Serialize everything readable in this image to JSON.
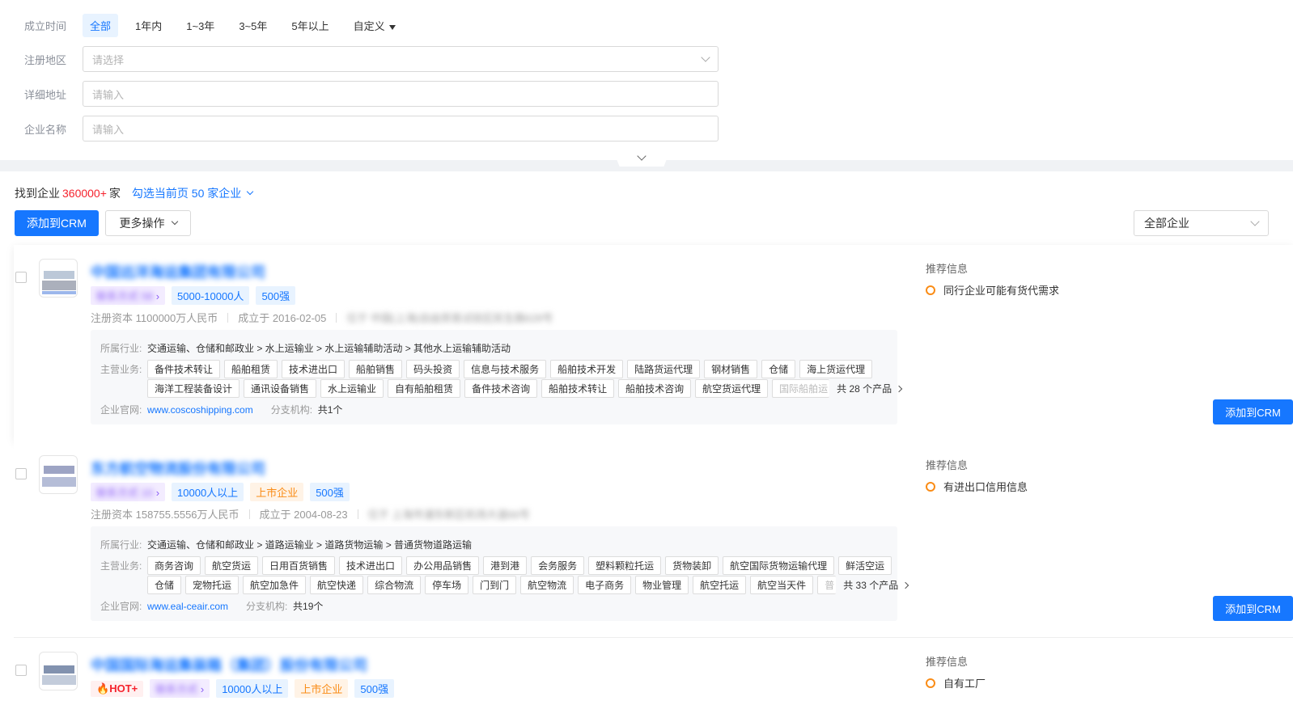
{
  "filters": {
    "founded": {
      "label": "成立时间",
      "options": [
        "全部",
        "1年内",
        "1~3年",
        "3~5年",
        "5年以上"
      ],
      "custom": "自定义"
    },
    "region": {
      "label": "注册地区",
      "placeholder": "请选择"
    },
    "address": {
      "label": "详细地址",
      "placeholder": "请输入"
    },
    "company_name": {
      "label": "企业名称",
      "placeholder": "请输入"
    }
  },
  "results": {
    "prefix": "找到企业",
    "count": "360000+",
    "suffix": "家",
    "select_page": "勾选当前页 50 家企业",
    "add_crm": "添加到CRM",
    "more_ops": "更多操作",
    "scope": "全部企业"
  },
  "companies": [
    {
      "name": "中国远洋海运集团有限公司",
      "contact_tag": "联系方式 58",
      "tags": [
        "5000-10000人",
        "500强"
      ],
      "capital": "注册资本 1100000万人民币",
      "founded": "成立于 2016-02-05",
      "location": "位于 中国(上海)自由贸易试验区民生路628号",
      "industry_label": "所属行业:",
      "industry": "交通运输、仓储和邮政业 > 水上运输业 > 水上运输辅助活动 > 其他水上运输辅助活动",
      "business_label": "主营业务:",
      "products_row1": [
        "备件技术转让",
        "船舶租赁",
        "技术进出口",
        "船舶销售",
        "码头投资",
        "信息与技术服务",
        "船舶技术开发",
        "陆路货运代理",
        "钢材销售",
        "仓储",
        "海上货运代理"
      ],
      "products_row2": [
        "海洋工程装备设计",
        "通讯设备销售",
        "水上运输业",
        "自有船舶租赁",
        "备件技术咨询",
        "船舶技术转让",
        "船舶技术咨询",
        "航空货运代理",
        "国际船舶运"
      ],
      "product_total": "共 28 个产品",
      "website_label": "企业官网:",
      "website": "www.coscoshipping.com",
      "branch_label": "分支机构:",
      "branch": "共1个",
      "rec_title": "推荐信息",
      "rec": "同行企业可能有货代需求",
      "add_crm": "添加到CRM"
    },
    {
      "name": "东方航空物流股份有限公司",
      "contact_tag": "联系方式 10",
      "tags": [
        "10000人以上",
        "上市企业",
        "500强"
      ],
      "capital": "注册资本 158755.5556万人民币",
      "founded": "成立于 2004-08-23",
      "location": "位于 上海市浦东新区机场大道66号",
      "industry_label": "所属行业:",
      "industry": "交通运输、仓储和邮政业 > 道路运输业 > 道路货物运输 > 普通货物道路运输",
      "business_label": "主营业务:",
      "products_row1": [
        "商务咨询",
        "航空货运",
        "日用百货销售",
        "技术进出口",
        "办公用品销售",
        "港到港",
        "会务服务",
        "塑料颗粒托运",
        "货物装卸",
        "航空国际货物运输代理",
        "鲜活空运"
      ],
      "products_row2": [
        "仓储",
        "宠物托运",
        "航空加急件",
        "航空快递",
        "综合物流",
        "停车场",
        "门到门",
        "航空物流",
        "电子商务",
        "物业管理",
        "航空托运",
        "航空当天件",
        "普"
      ],
      "product_total": "共 33 个产品",
      "website_label": "企业官网:",
      "website": "www.eal-ceair.com",
      "branch_label": "分支机构:",
      "branch": "共19个",
      "rec_title": "推荐信息",
      "rec": "有进出口信用信息",
      "add_crm": "添加到CRM"
    },
    {
      "name": "中国国际海运集装箱（集团）股份有限公司",
      "hot_tag": "HOT+",
      "contact_tag": "联系方式",
      "tags": [
        "10000人以上",
        "上市企业",
        "500强"
      ],
      "rec_title": "推荐信息",
      "rec": "自有工厂"
    }
  ],
  "colors": {
    "primary": "#1677ff",
    "count_red": "#f5222d",
    "rec_orange": "#fa8c16"
  }
}
